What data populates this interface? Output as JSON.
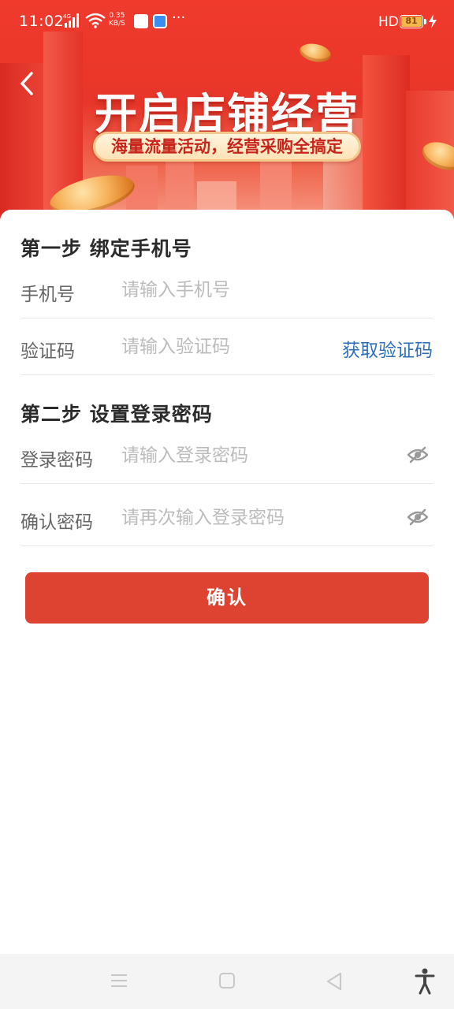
{
  "status_bar": {
    "time": "11:02",
    "network_label": "4G",
    "speed_value": "0.35",
    "speed_unit": "KB/S",
    "more": "···",
    "hd_label": "HD",
    "battery_level": "81",
    "icons": [
      "signal-icon",
      "wifi-icon",
      "app-notification-icon",
      "app-notification-icon-2",
      "battery-icon",
      "charging-icon"
    ]
  },
  "banner": {
    "title": "开启店铺经营",
    "subtitle": "海量流量活动，经营采购全搞定",
    "colors": {
      "primary": "#e8362a",
      "pill_text": "#c8241a",
      "pill_bg": "#fde2b6"
    }
  },
  "step1": {
    "title": "第一步 绑定手机号",
    "phone_label": "手机号",
    "phone_placeholder": "请输入手机号",
    "code_label": "验证码",
    "code_placeholder": "请输入验证码",
    "get_code": "获取验证码"
  },
  "step2": {
    "title": "第二步 设置登录密码",
    "password_label": "登录密码",
    "password_placeholder": "请输入登录密码",
    "confirm_label": "确认密码",
    "confirm_placeholder": "请再次输入登录密码"
  },
  "confirm_button": "确认",
  "colors": {
    "accent_button": "#dd4330",
    "link": "#2e6fb7",
    "placeholder": "#bcbcbc"
  },
  "nav_bar": {
    "icons": [
      "menu-icon",
      "home-icon",
      "back-triangle-icon",
      "accessibility-icon"
    ]
  }
}
